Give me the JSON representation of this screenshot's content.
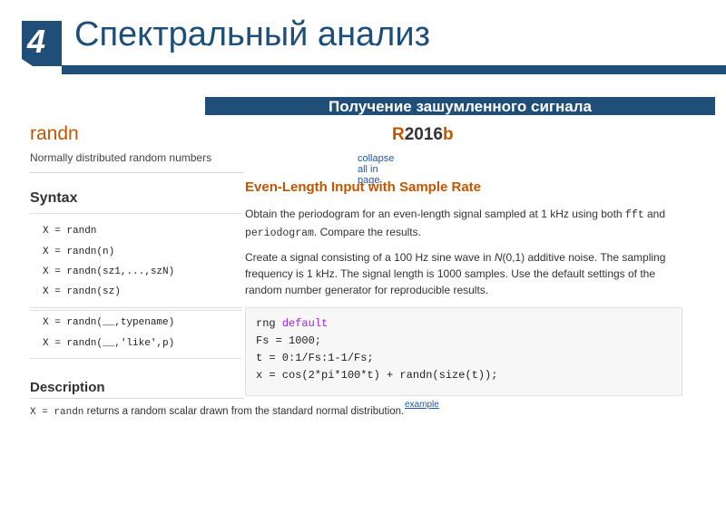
{
  "slide": {
    "number": "4",
    "title": "Спектральный анализ",
    "subtitle": "Получение зашумленного сигнала",
    "colors": {
      "primary": "#1f4e79",
      "accent": "#c45500",
      "link": "#1a5aa8"
    }
  },
  "doc": {
    "function_name": "randn",
    "release": {
      "r": "R",
      "year": "2016",
      "b": "b"
    },
    "summary": "Normally distributed random numbers",
    "collapse": "collapse all in page",
    "syntax_heading": "Syntax",
    "syntax_group1": [
      "X = randn",
      "X = randn(n)",
      "X = randn(sz1,...,szN)",
      "X = randn(sz)"
    ],
    "syntax_group2": [
      "X = randn(__,typename)",
      "X = randn(__,'like',p)"
    ],
    "description_heading": "Description",
    "description_code": "X = randn",
    "description_text": " returns a random scalar drawn from the standard normal distribution."
  },
  "example": {
    "title": "Even-Length Input with Sample Rate",
    "p1_a": "Obtain the periodogram for an even-length signal sampled at 1 kHz using both ",
    "p1_fft": "fft",
    "p1_b": " and ",
    "p1_periodogram": "periodogram",
    "p1_c": ". Compare the results.",
    "p2_a": "Create a signal consisting of a 100 Hz sine wave in ",
    "p2_n": "N",
    "p2_b": "(0,1) additive noise. The sampling frequency is 1 kHz. The signal length is 1000 samples. Use the default settings of the random number generator for reproducible results.",
    "code_line1_a": "rng ",
    "code_line1_kw": "default",
    "code_line2": "Fs = 1000;",
    "code_line3": "t = 0:1/Fs:1-1/Fs;",
    "code_line4": "x = cos(2*pi*100*t) + randn(size(t));",
    "link": "example"
  }
}
